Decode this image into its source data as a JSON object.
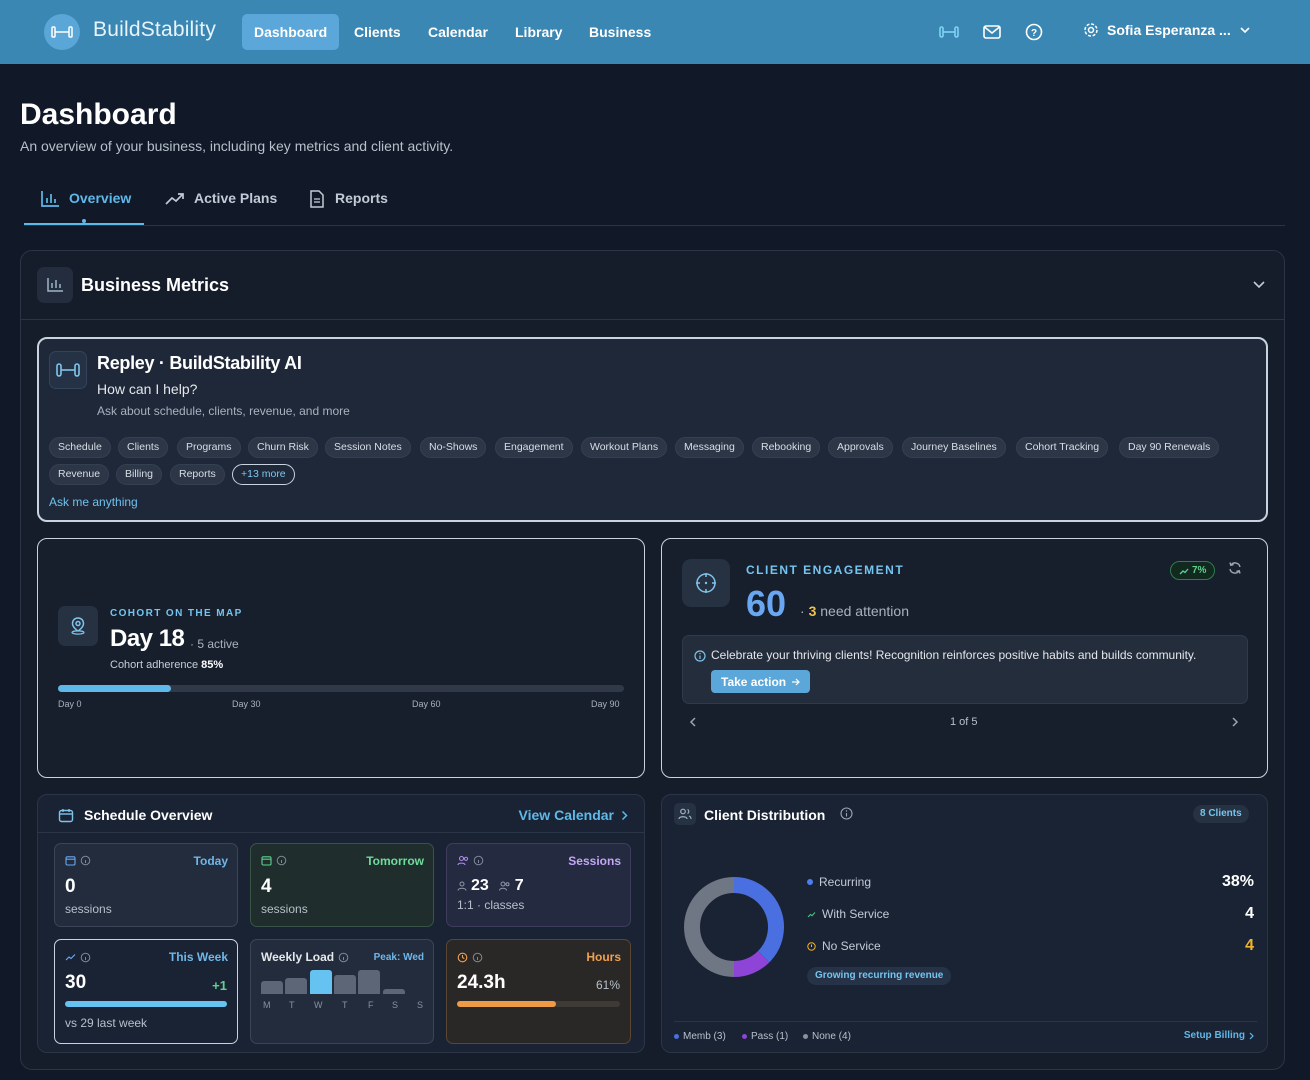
{
  "app": {
    "brand": "BuildStability"
  },
  "nav": {
    "items": [
      "Dashboard",
      "Clients",
      "Calendar",
      "Library",
      "Business"
    ],
    "active": "Dashboard",
    "user": "Sofia Esperanza ..."
  },
  "page": {
    "title": "Dashboard",
    "subtitle": "An overview of your business, including key metrics and client activity."
  },
  "tabs": [
    "Overview",
    "Active Plans",
    "Reports"
  ],
  "metrics_panel": {
    "title": "Business Metrics"
  },
  "assistant": {
    "title": "Repley · BuildStability AI",
    "prompt": "How can I help?",
    "description": "Ask about schedule, clients, revenue, and more",
    "chips": [
      "Schedule",
      "Clients",
      "Programs",
      "Churn Risk",
      "Session Notes",
      "No-Shows",
      "Engagement",
      "Workout Plans",
      "Messaging",
      "Rebooking",
      "Approvals",
      "Journey Baselines",
      "Cohort Tracking",
      "Day 90 Renewals",
      "Revenue",
      "Billing",
      "Reports"
    ],
    "more_chip": "+13 more",
    "ask": "Ask me anything"
  },
  "cohort": {
    "label": "COHORT ON THE MAP",
    "day": "Day 18",
    "active": "· 5 active",
    "adherence_label": "Cohort adherence",
    "adherence_value": "85%",
    "progress": 0.2,
    "ticks": [
      "Day 0",
      "Day 30",
      "Day 60",
      "Day 90"
    ]
  },
  "engagement": {
    "label": "CLIENT ENGAGEMENT",
    "score": "60",
    "need_count": "3",
    "need_text": "need attention",
    "trend": "7%",
    "message": "Celebrate your thriving clients! Recognition reinforces positive habits and builds community.",
    "action": "Take action",
    "pager": "1 of 5"
  },
  "schedule": {
    "title": "Schedule Overview",
    "link": "View Calendar",
    "today": {
      "label": "Today",
      "value": "0",
      "unit": "sessions"
    },
    "tomorrow": {
      "label": "Tomorrow",
      "value": "4",
      "unit": "sessions"
    },
    "sessions": {
      "label": "Sessions",
      "one_on_one": "23",
      "classes": "7",
      "unit": "1:1 · classes"
    },
    "this_week": {
      "label": "This Week",
      "value": "30",
      "delta": "+1",
      "compare": "vs 29 last week",
      "fill": 1.0
    },
    "weekly_load": {
      "label": "Weekly Load",
      "peak": "Peak: Wed",
      "days": [
        "M",
        "T",
        "W",
        "T",
        "S",
        "S"
      ],
      "day_f": "F",
      "levels": [
        0.55,
        0.65,
        1.0,
        0.8,
        1.0,
        0.2,
        0.0
      ]
    },
    "hours": {
      "label": "Hours",
      "value": "24.3h",
      "percent": "61%",
      "fill": 0.61
    }
  },
  "distribution": {
    "title": "Client Distribution",
    "badge": "8 Clients",
    "legend": [
      {
        "name": "Recurring",
        "value": "38%",
        "color": "#4f7cf0"
      },
      {
        "name": "With Service",
        "value": "4",
        "color": "#4fc27d"
      },
      {
        "name": "No Service",
        "value": "4",
        "color": "#f0b429"
      }
    ],
    "growth": "Growing recurring revenue",
    "keys": [
      "Memb (3)",
      "Pass (1)",
      "None (4)"
    ],
    "setup": "Setup Billing",
    "chart_data": {
      "type": "pie",
      "categories": [
        "Memb",
        "Pass",
        "None"
      ],
      "values": [
        3,
        1,
        4
      ],
      "colors": [
        "#4a6fe0",
        "#8e44d6",
        "#6f7684"
      ]
    }
  },
  "colors": {
    "accent": "#5fb8ea",
    "topbar": "#3b87b4",
    "background": "#111827"
  }
}
